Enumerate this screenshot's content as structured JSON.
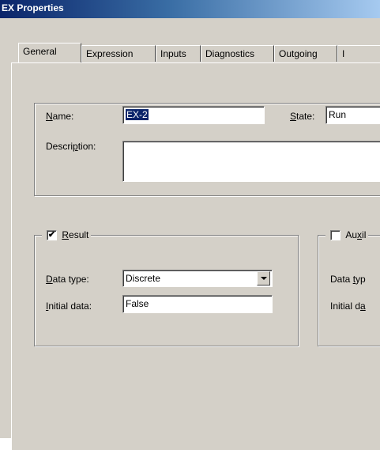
{
  "window": {
    "title": "EX Properties"
  },
  "tabs": [
    {
      "label": "General",
      "active": true
    },
    {
      "label": "Expression"
    },
    {
      "label": "Inputs"
    },
    {
      "label": "Diagnostics"
    },
    {
      "label": "Outgoing"
    },
    {
      "label": "I"
    }
  ],
  "general": {
    "name_label": "Name:",
    "name_value": "EX-2",
    "state_label": "State:",
    "state_value": "Run",
    "description_label": "Description:",
    "description_value": ""
  },
  "result": {
    "checkbox_label": "Result",
    "checked": true,
    "data_type_label": "Data type:",
    "data_type_value": "Discrete",
    "initial_data_label": "Initial data:",
    "initial_data_value": "False"
  },
  "auxiliary": {
    "checkbox_label": "Auxil",
    "checked": false,
    "data_type_label": "Data typ",
    "initial_data_label": "Initial da"
  }
}
